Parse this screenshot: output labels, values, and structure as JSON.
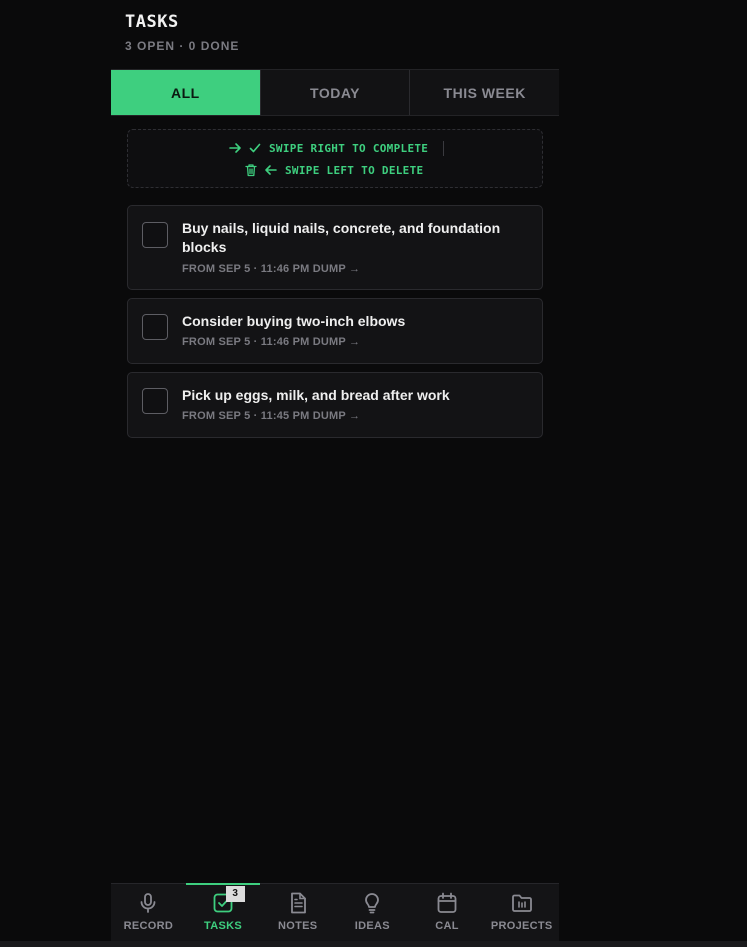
{
  "header": {
    "title": "TASKS",
    "subtitle": "3 OPEN · 0 DONE"
  },
  "tabs": [
    {
      "label": "ALL",
      "active": true
    },
    {
      "label": "TODAY",
      "active": false
    },
    {
      "label": "THIS WEEK",
      "active": false
    }
  ],
  "hint": {
    "complete": "SWIPE RIGHT TO COMPLETE",
    "delete": "SWIPE LEFT TO DELETE"
  },
  "tasks": [
    {
      "title": "Buy nails, liquid nails, concrete, and foundation blocks",
      "meta": "FROM SEP 5 · 11:46 PM DUMP",
      "done": false
    },
    {
      "title": "Consider buying two-inch elbows",
      "meta": "FROM SEP 5 · 11:46 PM DUMP",
      "done": false
    },
    {
      "title": "Pick up eggs, milk, and bread after work",
      "meta": "FROM SEP 5 · 11:45 PM DUMP",
      "done": false
    }
  ],
  "meta_arrow": "→",
  "nav": {
    "items": [
      {
        "label": "RECORD",
        "icon": "microphone-icon"
      },
      {
        "label": "TASKS",
        "icon": "checkbox-icon",
        "active": true,
        "badge": "3"
      },
      {
        "label": "NOTES",
        "icon": "document-icon"
      },
      {
        "label": "IDEAS",
        "icon": "lightbulb-icon"
      },
      {
        "label": "CAL",
        "icon": "calendar-icon"
      },
      {
        "label": "PROJECTS",
        "icon": "folder-icon"
      }
    ]
  },
  "colors": {
    "accent": "#3ecf7f",
    "background": "#0a0a0b",
    "card": "#131315"
  }
}
